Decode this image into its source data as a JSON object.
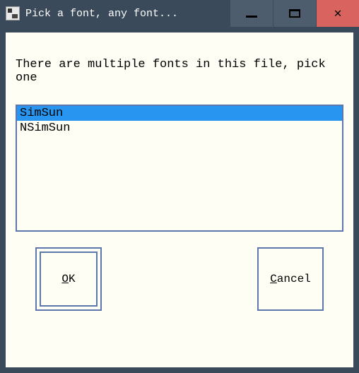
{
  "window": {
    "title": "Pick a font, any font..."
  },
  "dialog": {
    "prompt": "There are multiple fonts in this file, pick one",
    "list": {
      "items": [
        "SimSun",
        "NSimSun"
      ],
      "selected_index": 0
    },
    "buttons": {
      "ok": {
        "mnemonic": "O",
        "rest": "K"
      },
      "cancel": {
        "mnemonic": "C",
        "rest": "ancel"
      }
    }
  }
}
